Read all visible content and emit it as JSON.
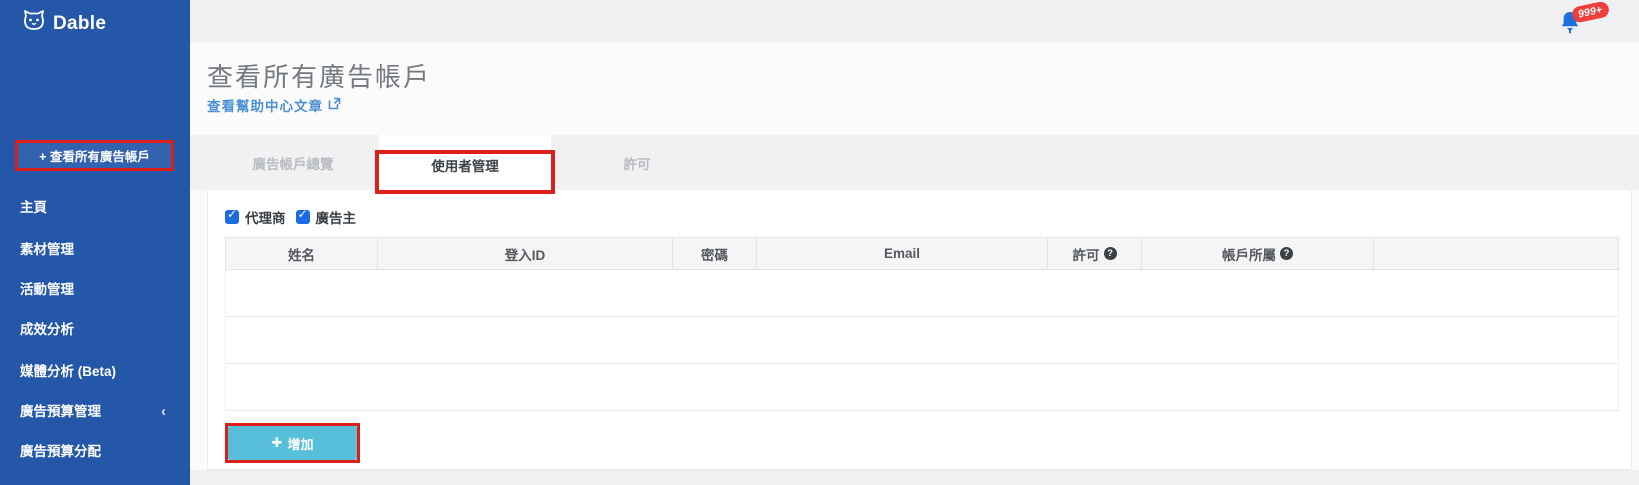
{
  "brand": {
    "name": "Dable"
  },
  "notifications": {
    "badge": "999+"
  },
  "sidebar": {
    "highlighted_item": {
      "label": "+ 查看所有廣告帳戶"
    },
    "items": [
      {
        "label": "主頁"
      },
      {
        "label": "素材管理"
      },
      {
        "label": "活動管理"
      },
      {
        "label": "成效分析"
      },
      {
        "label": "媒體分析 (Beta)"
      },
      {
        "label": "廣告預算管理",
        "chevron": "‹"
      },
      {
        "label": "廣告預算分配"
      }
    ]
  },
  "page": {
    "title": "查看所有廣告帳戶",
    "help_link": "查看幫助中心文章"
  },
  "tabs": [
    {
      "label": "廣告帳戶總覽",
      "active": false
    },
    {
      "label": "使用者管理",
      "active": true,
      "annotated": true
    },
    {
      "label": "許可",
      "active": false
    }
  ],
  "filters": [
    {
      "label": "代理商",
      "checked": true
    },
    {
      "label": "廣告主",
      "checked": true
    }
  ],
  "table": {
    "columns": [
      "姓名",
      "登入ID",
      "密碼",
      "Email",
      "許可",
      "帳戶所屬",
      ""
    ],
    "help_icon": "?",
    "columns_with_help": [
      4,
      5
    ],
    "rows": [
      [
        "",
        "",
        "",
        "",
        "",
        "",
        ""
      ],
      [
        "",
        "",
        "",
        "",
        "",
        "",
        ""
      ],
      [
        "",
        "",
        "",
        "",
        "",
        "",
        ""
      ]
    ]
  },
  "actions": {
    "add_icon": "✚",
    "add_label": "增加"
  },
  "colors": {
    "sidebar_blue": "#2457A8",
    "annotation_red": "#DC1F1B",
    "add_button_cyan": "#58BFDB",
    "link_blue": "#4B90D5",
    "checkbox_blue": "#1B6CE0",
    "bell_blue": "#1E6FD9",
    "badge_red": "#EE3F3D",
    "tab_inactive_gray": "#B9BDC1",
    "header_bg": "#F5F5F6"
  }
}
